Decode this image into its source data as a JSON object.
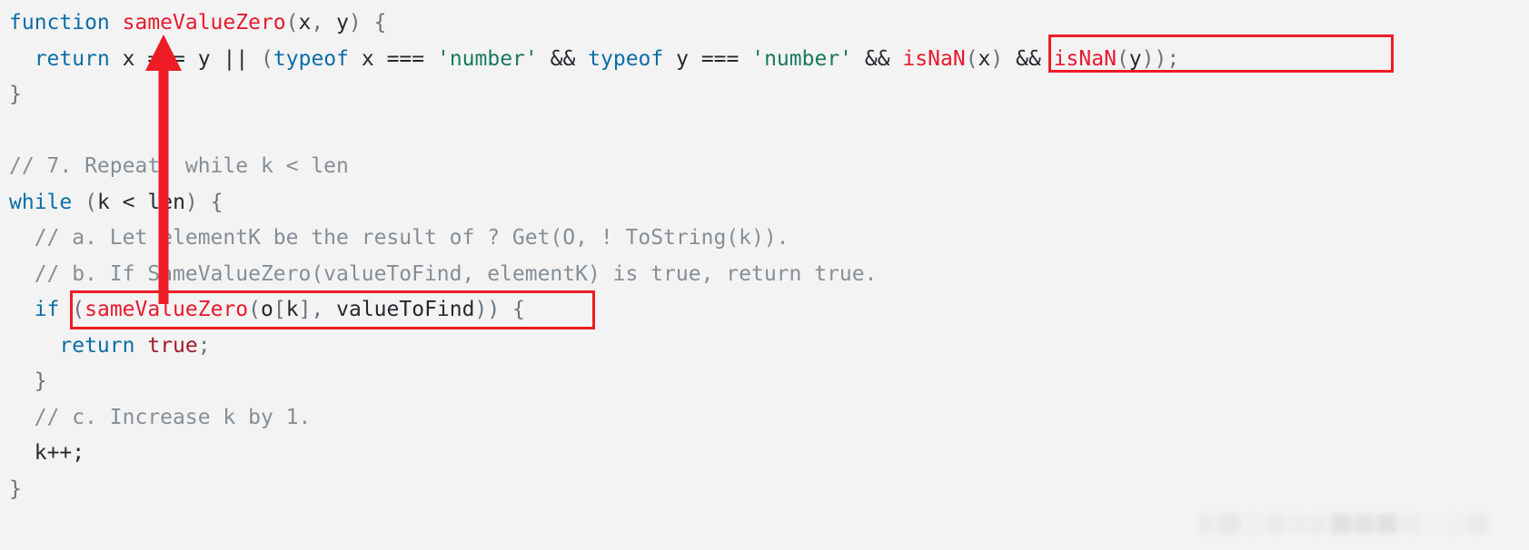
{
  "editor": {
    "background_color": "#f3f3f3",
    "font_size_px": 23,
    "language": "javascript"
  },
  "annotation": {
    "color": "#ee1c24",
    "boxes": [
      {
        "name": "isnan-check-box",
        "target_text": "isNaN(x) && isNaN(y));"
      },
      {
        "name": "samevaluezero-call-box",
        "target_text": "(sameValueZero(o[k], valueToFind))"
      }
    ],
    "arrow": {
      "name": "callee-definition-arrow",
      "from_text": "(sameValueZero(o[k], valueToFind))",
      "to_text": "sameValueZero"
    }
  },
  "code": {
    "lines": [
      {
        "n": 1,
        "tokens": [
          {
            "t": "function ",
            "c": "kw"
          },
          {
            "t": "sameValueZero",
            "c": "fn"
          },
          {
            "t": "(",
            "c": "punc"
          },
          {
            "t": "x",
            "c": "var"
          },
          {
            "t": ", ",
            "c": "punc"
          },
          {
            "t": "y",
            "c": "var"
          },
          {
            "t": ") ",
            "c": "punc"
          },
          {
            "t": "{",
            "c": "punc"
          }
        ]
      },
      {
        "n": 2,
        "tokens": [
          {
            "t": "  ",
            "c": "var"
          },
          {
            "t": "return",
            "c": "kw"
          },
          {
            "t": " ",
            "c": "var"
          },
          {
            "t": "x",
            "c": "var"
          },
          {
            "t": " === ",
            "c": "op"
          },
          {
            "t": "y",
            "c": "var"
          },
          {
            "t": " ",
            "c": "var"
          },
          {
            "t": "||",
            "c": "op"
          },
          {
            "t": " ",
            "c": "var"
          },
          {
            "t": "(",
            "c": "punc"
          },
          {
            "t": "typeof",
            "c": "kw"
          },
          {
            "t": " ",
            "c": "var"
          },
          {
            "t": "x",
            "c": "var"
          },
          {
            "t": " === ",
            "c": "op"
          },
          {
            "t": "'number'",
            "c": "str"
          },
          {
            "t": " ",
            "c": "var"
          },
          {
            "t": "&&",
            "c": "op"
          },
          {
            "t": " ",
            "c": "var"
          },
          {
            "t": "typeof",
            "c": "kw"
          },
          {
            "t": " ",
            "c": "var"
          },
          {
            "t": "y",
            "c": "var"
          },
          {
            "t": " === ",
            "c": "op"
          },
          {
            "t": "'number'",
            "c": "str"
          },
          {
            "t": " ",
            "c": "var"
          },
          {
            "t": "&&",
            "c": "op"
          },
          {
            "t": " ",
            "c": "var"
          },
          {
            "t": "isNaN",
            "c": "fn"
          },
          {
            "t": "(",
            "c": "punc"
          },
          {
            "t": "x",
            "c": "var"
          },
          {
            "t": ")",
            "c": "punc"
          },
          {
            "t": " ",
            "c": "var"
          },
          {
            "t": "&&",
            "c": "op"
          },
          {
            "t": " ",
            "c": "var"
          },
          {
            "t": "isNaN",
            "c": "fn"
          },
          {
            "t": "(",
            "c": "punc"
          },
          {
            "t": "y",
            "c": "var"
          },
          {
            "t": "));",
            "c": "punc"
          }
        ]
      },
      {
        "n": 3,
        "tokens": [
          {
            "t": "}",
            "c": "punc"
          }
        ]
      },
      {
        "n": 4,
        "tokens": []
      },
      {
        "n": 5,
        "tokens": [
          {
            "t": "// 7. Repeat, while k < len",
            "c": "cmt"
          }
        ]
      },
      {
        "n": 6,
        "tokens": [
          {
            "t": "while",
            "c": "kw"
          },
          {
            "t": " ",
            "c": "var"
          },
          {
            "t": "(",
            "c": "punc"
          },
          {
            "t": "k",
            "c": "var"
          },
          {
            "t": " < ",
            "c": "op"
          },
          {
            "t": "len",
            "c": "var"
          },
          {
            "t": ") ",
            "c": "punc"
          },
          {
            "t": "{",
            "c": "punc"
          }
        ]
      },
      {
        "n": 7,
        "tokens": [
          {
            "t": "  // a. Let elementK be the result of ? Get(O, ! ToString(k)).",
            "c": "cmt"
          }
        ]
      },
      {
        "n": 8,
        "tokens": [
          {
            "t": "  // b. If SameValueZero(valueToFind, elementK) is true, return true.",
            "c": "cmt"
          }
        ]
      },
      {
        "n": 9,
        "tokens": [
          {
            "t": "  ",
            "c": "var"
          },
          {
            "t": "if",
            "c": "kw"
          },
          {
            "t": " ",
            "c": "var"
          },
          {
            "t": "(",
            "c": "punc"
          },
          {
            "t": "sameValueZero",
            "c": "fn"
          },
          {
            "t": "(",
            "c": "punc"
          },
          {
            "t": "o",
            "c": "var"
          },
          {
            "t": "[",
            "c": "punc"
          },
          {
            "t": "k",
            "c": "var"
          },
          {
            "t": "]",
            "c": "punc"
          },
          {
            "t": ", ",
            "c": "punc"
          },
          {
            "t": "valueToFind",
            "c": "var"
          },
          {
            "t": "))",
            "c": "punc"
          },
          {
            "t": " ",
            "c": "var"
          },
          {
            "t": "{",
            "c": "punc"
          }
        ]
      },
      {
        "n": 10,
        "tokens": [
          {
            "t": "    ",
            "c": "var"
          },
          {
            "t": "return",
            "c": "kw"
          },
          {
            "t": " ",
            "c": "var"
          },
          {
            "t": "true",
            "c": "bool"
          },
          {
            "t": ";",
            "c": "punc"
          }
        ]
      },
      {
        "n": 11,
        "tokens": [
          {
            "t": "  }",
            "c": "punc"
          }
        ]
      },
      {
        "n": 12,
        "tokens": [
          {
            "t": "  // c. Increase k by 1.",
            "c": "cmt"
          }
        ]
      },
      {
        "n": 13,
        "tokens": [
          {
            "t": "  ",
            "c": "var"
          },
          {
            "t": "k",
            "c": "var"
          },
          {
            "t": "++;",
            "c": "op"
          }
        ]
      },
      {
        "n": 14,
        "tokens": [
          {
            "t": "}",
            "c": "punc"
          }
        ]
      }
    ]
  },
  "watermark": {
    "name": "blurred-watermark",
    "visible": true
  }
}
